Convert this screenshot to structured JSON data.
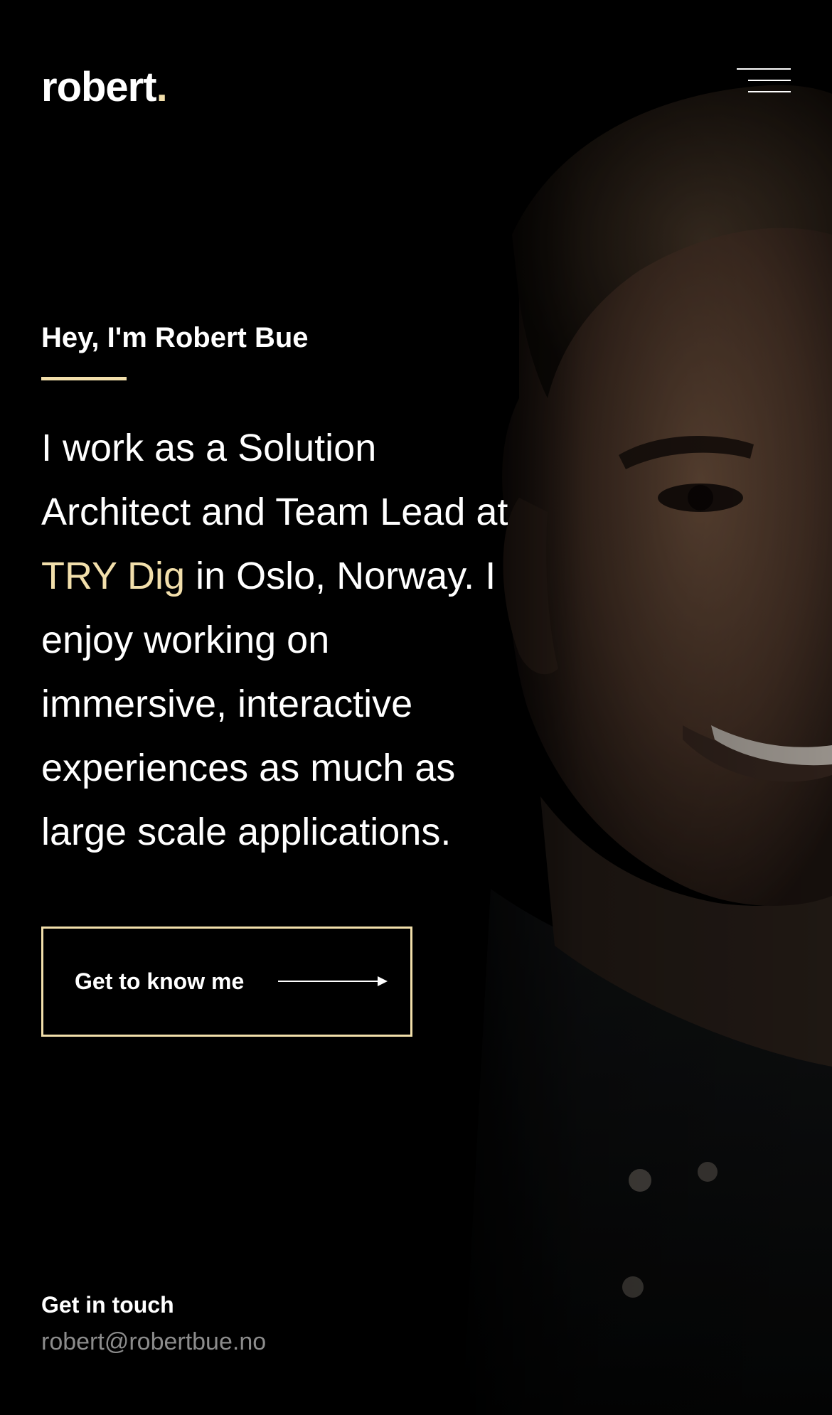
{
  "header": {
    "logo_text": "robert",
    "logo_dot": ".",
    "menu_icon": "hamburger-menu-icon"
  },
  "intro": {
    "greeting": "Hey, I'm Robert Bue",
    "bio_before": "I work as a Solution Architect and Team Lead at ",
    "bio_company": "TRY Dig",
    "bio_after": " in Oslo, Norway. I enjoy working on immersive, interactive experiences as much as large scale applications."
  },
  "cta": {
    "label": "Get to know me",
    "icon": "arrow-right-icon"
  },
  "contact": {
    "heading": "Get in touch",
    "email": "robert@robertbue.no"
  },
  "colors": {
    "background": "#000000",
    "accent": "#f2dfab",
    "text": "#ffffff",
    "muted": "#8c8c8c"
  }
}
